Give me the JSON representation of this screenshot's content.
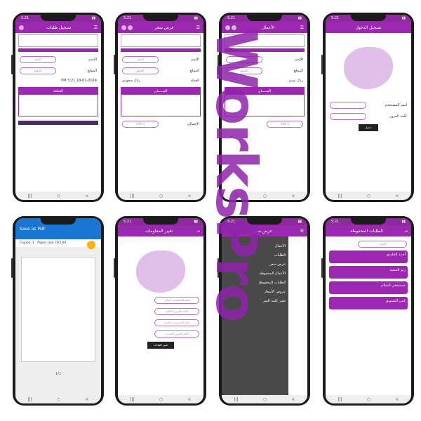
{
  "watermark": "WorksPro",
  "phone1": {
    "title": "تسجيل طلبات",
    "l1": "الإسم",
    "l2": "الموقع",
    "f1": "الإسم",
    "f2": "الموقع",
    "date": "18-01-2024 PM 5:21",
    "thead": "السلعة"
  },
  "phone2": {
    "title": "عرض سعر",
    "l1": "الإسم",
    "l2": "الموقع",
    "f1": "الإسم",
    "f2": "الموقع",
    "cur": "ريال سعودي",
    "currency": "العملة",
    "thead": "البيـــــان",
    "total": "الإجمالي",
    "sar": "SAR 0"
  },
  "phone3": {
    "title": "الأعمال",
    "l1": "الإسم",
    "l2": "الموقع",
    "f1": "الإسم",
    "f2": "الموقع",
    "cur": "ريال يمني",
    "thead": "البيـــــان",
    "sar": "SAR 0"
  },
  "phone4": {
    "title": "تسجيل الدخول",
    "l1": "اسم المستخدم",
    "l2": "كلمة المرور",
    "btn": "دخول"
  },
  "phone5": {
    "title": "Save as PDF",
    "copies": "Copies: 1",
    "paper": "Paper size: ISO A4",
    "page": "1/1"
  },
  "phone6": {
    "title": "تغيير المعلومات",
    "f1": "اسم المستخدم الحالي",
    "f2": "كلمة المرور الحالية",
    "f3": "اسم المستخدم الجديد",
    "f4": "كلمة المرور الجديدة",
    "btn": "تغيير البيانات"
  },
  "phone7": {
    "title": "عرض سعر",
    "menu": [
      "الأعمال",
      "الطلبات",
      "عرض سعر",
      "الأعمال المحفوظة",
      "الطلبات المحفوظة",
      "عروض الأسعار",
      "تغيير كلمة السر"
    ]
  },
  "phone8": {
    "title": "الطلبات المحفوظة",
    "search": "البحث",
    "cards": [
      "أحمد الخليدي",
      "ريم السعيد",
      "مستشفى السلام",
      "كتبي للتسويق"
    ]
  }
}
